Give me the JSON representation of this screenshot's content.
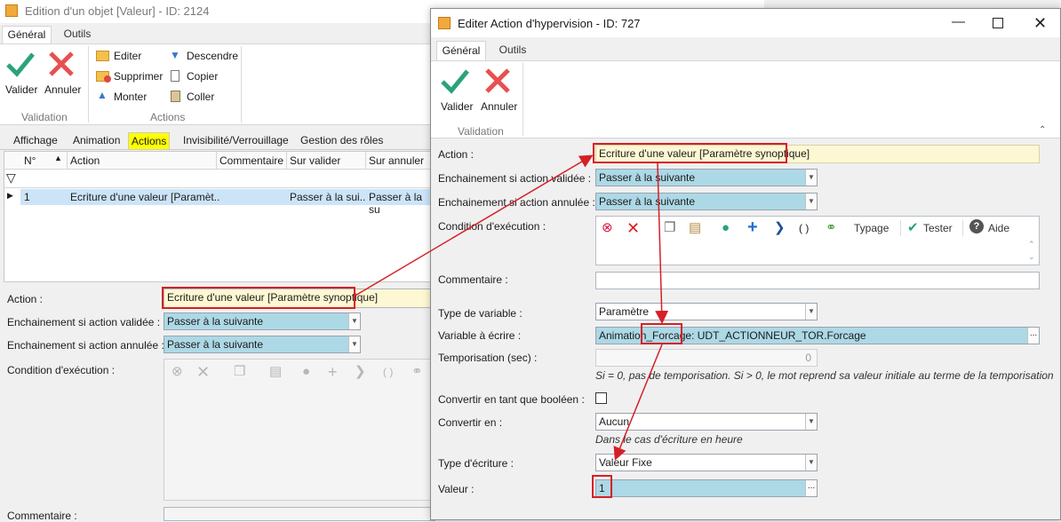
{
  "back_window": {
    "title": "Edition d'un objet [Valeur] - ID: 2124",
    "ribbon_tabs": [
      "Général",
      "Outils"
    ],
    "ribbon": {
      "valider": "Valider",
      "annuler": "Annuler",
      "group_validation": "Validation",
      "editer": "Editer",
      "supprimer": "Supprimer",
      "monter": "Monter",
      "descendre": "Descendre",
      "copier": "Copier",
      "coller": "Coller",
      "group_actions": "Actions"
    },
    "tabs": [
      "Affichage",
      "Animation",
      "Actions",
      "Invisibilité/Verrouillage",
      "Gestion des rôles"
    ],
    "grid_headers": [
      "N°",
      "Action",
      "Commentaire",
      "Sur valider",
      "Sur annuler"
    ],
    "grid_row": {
      "num": "1",
      "action": "Ecriture d'une valeur [Paramèt..",
      "commentaire": "",
      "sur_valider": "Passer à la sui..",
      "sur_annuler": "Passer à la su"
    },
    "form": {
      "action_label": "Action :",
      "action_value": "Ecriture d'une valeur [Paramètre synoptique]",
      "valid_label": "Enchainement si action validée :",
      "valid_value": "Passer à la suivante",
      "annul_label": "Enchainement si action annulée :",
      "annul_value": "Passer à la suivante",
      "condition_label": "Condition d'exécution :",
      "commentaire_label": "Commentaire :"
    }
  },
  "front_window": {
    "title": "Editer Action d'hypervision - ID: 727",
    "ribbon_tabs": [
      "Général",
      "Outils"
    ],
    "ribbon": {
      "valider": "Valider",
      "annuler": "Annuler",
      "group_validation": "Validation"
    },
    "form": {
      "action_label": "Action :",
      "action_value": "Ecriture d'une valeur [Paramètre synoptique]",
      "valid_label": "Enchainement si action validée :",
      "valid_value": "Passer à la suivante",
      "annul_label": "Enchainement si action annulée :",
      "annul_value": "Passer à la suivante",
      "condition_label": "Condition d'exécution :",
      "toolbar": {
        "typage": "Typage",
        "tester": "Tester",
        "aide": "Aide",
        "parens": "( )"
      },
      "commentaire_label": "Commentaire :",
      "commentaire_value": "",
      "type_var_label": "Type de variable :",
      "type_var_value": "Paramètre",
      "var_label": "Variable à écrire :",
      "var_part1": "Animation_",
      "var_part2": "Forcage",
      "var_part3": ": UDT_ACTIONNEUR_TOR.Forcage",
      "tempo_label": "Temporisation (sec) :",
      "tempo_value": "0",
      "tempo_hint": "Si = 0, pas de temporisation. Si > 0, le mot reprend sa valeur initiale au terme de la temporisation",
      "bool_label": "Convertir en tant que booléen :",
      "convert_label": "Convertir en :",
      "convert_value": "Aucun",
      "convert_hint": "Dans le cas d'écriture en heure",
      "type_ecr_label": "Type d'écriture :",
      "type_ecr_value": "Valeur Fixe",
      "valeur_label": "Valeur :",
      "valeur_value": "1"
    }
  },
  "colors": {
    "combo_bg": "#add8e6",
    "highlight_field": "#fdf8d3",
    "annotation_red": "#d61f26",
    "tab_highlight": "#ffff00"
  }
}
